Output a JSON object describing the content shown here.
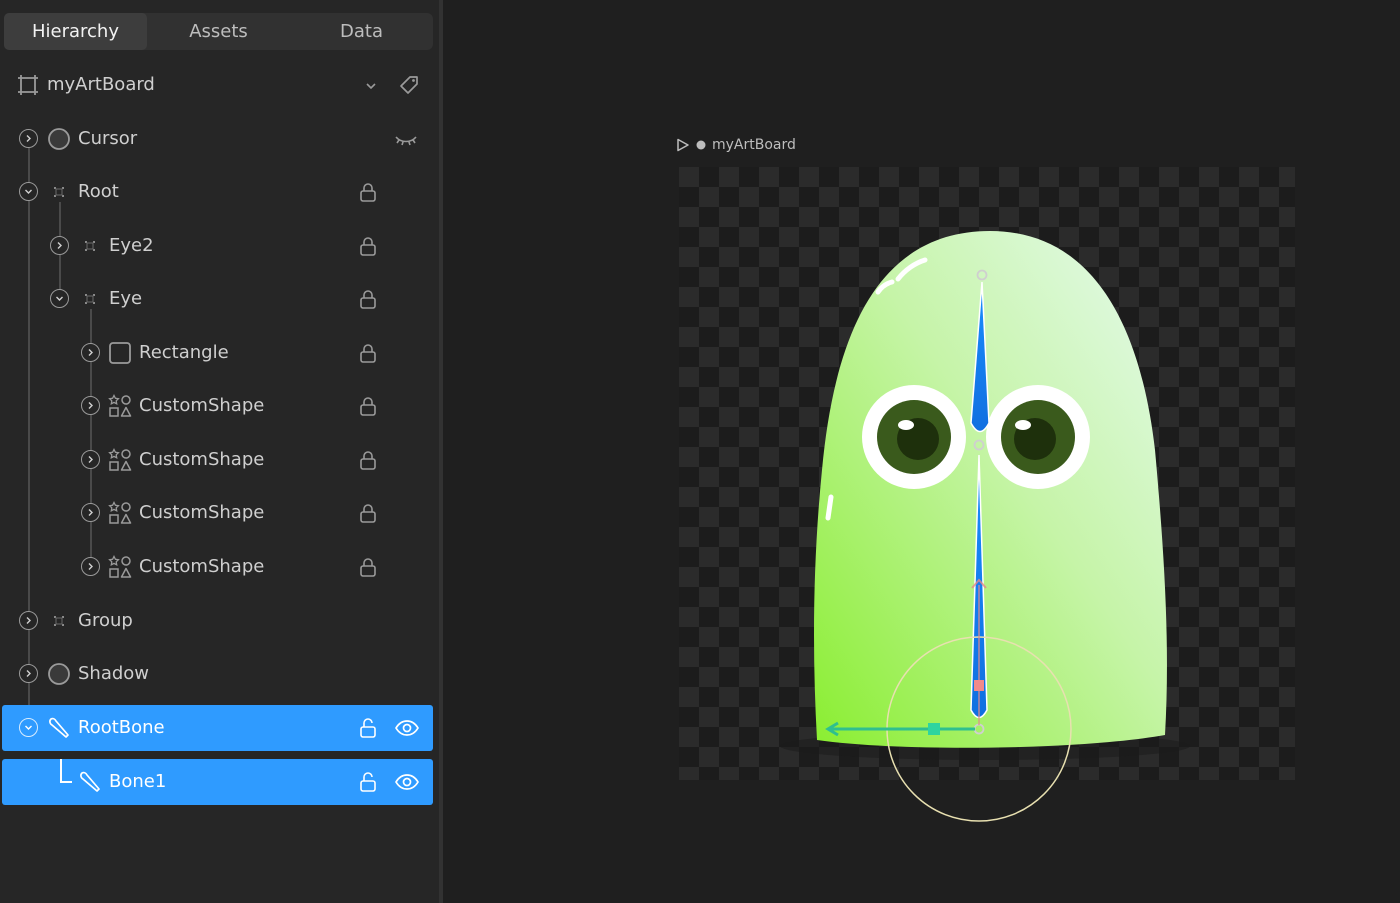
{
  "tabs": [
    "Hierarchy",
    "Assets",
    "Data"
  ],
  "artboard": {
    "name": "myArtBoard"
  },
  "hierarchy": [
    {
      "label": "Cursor",
      "icon": "ellipse-icon",
      "right_icon": "eye-closed-icon"
    },
    {
      "label": "Root",
      "icon": "group-icon",
      "right_icon": "lock-icon"
    },
    {
      "label": "Eye2",
      "icon": "group-icon",
      "right_icon": "lock-icon"
    },
    {
      "label": "Eye",
      "icon": "group-icon",
      "right_icon": "lock-icon"
    },
    {
      "label": "Rectangle",
      "icon": "rectangle-icon",
      "right_icon": "lock-icon"
    },
    {
      "label": "CustomShape",
      "icon": "custom-shape-icon",
      "right_icon": "lock-icon"
    },
    {
      "label": "CustomShape",
      "icon": "custom-shape-icon",
      "right_icon": "lock-icon"
    },
    {
      "label": "CustomShape",
      "icon": "custom-shape-icon",
      "right_icon": "lock-icon"
    },
    {
      "label": "CustomShape",
      "icon": "custom-shape-icon",
      "right_icon": "lock-icon"
    },
    {
      "label": "Group",
      "icon": "group-icon",
      "right_icon": ""
    },
    {
      "label": "Shadow",
      "icon": "ellipse-icon",
      "right_icon": ""
    },
    {
      "label": "RootBone",
      "icon": "bone-icon",
      "right_icon": "unlock-icon",
      "selected": true
    },
    {
      "label": "Bone1",
      "icon": "bone-icon",
      "right_icon": "unlock-icon",
      "selected": true
    }
  ],
  "canvas": {
    "artboard_label": "myArtBoard"
  },
  "colors": {
    "selection": "#2f9bff",
    "bone": "#1a8cff",
    "character_top": "#dff7e6",
    "character_bottom": "#8ff03a"
  }
}
